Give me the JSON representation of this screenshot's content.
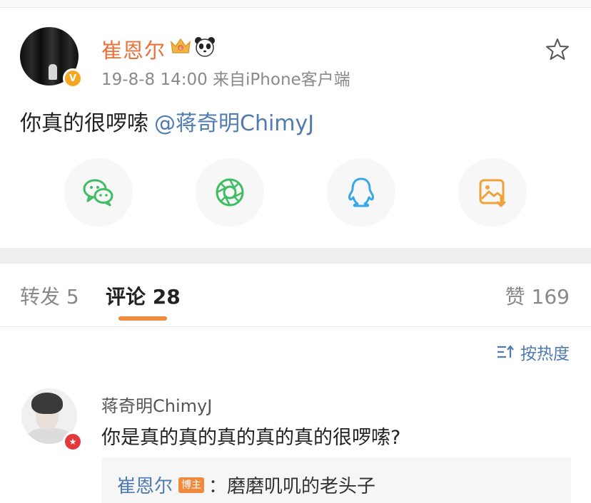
{
  "post": {
    "username": "崔恩尔",
    "meta": "19-8-8 14:00 来自iPhone客户端",
    "text": "你真的很啰嗦",
    "mention": "@蒋奇明ChimyJ",
    "badge_verified": "V"
  },
  "share_icons": [
    "wechat-icon",
    "moments-icon",
    "qq-icon",
    "save-image-icon"
  ],
  "tabs": [
    {
      "label": "转发 5"
    },
    {
      "label": "评论 28"
    },
    {
      "label": "赞 169"
    }
  ],
  "sort": {
    "label": "按热度"
  },
  "comment": {
    "name": "蒋奇明ChimyJ",
    "text": "你是真的真的真的真的真的很啰嗦?",
    "reply": {
      "name": "崔恩尔",
      "tag": "博主",
      "text": "：磨磨叽叽的老头子"
    }
  },
  "colors": {
    "accent_orange": "#e8733a",
    "link_blue": "#4f7bb0",
    "tab_underline": "#f08a3c"
  }
}
